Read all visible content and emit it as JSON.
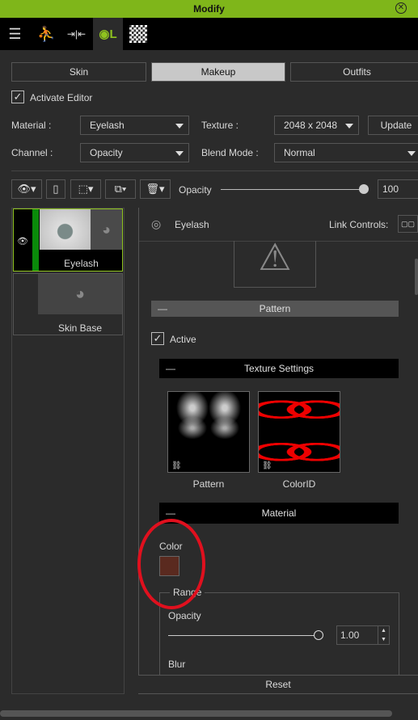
{
  "window": {
    "title": "Modify"
  },
  "toolbar_tabs": [
    {
      "icon": "sliders-icon",
      "glyph": "☰"
    },
    {
      "icon": "motion-icon",
      "glyph": "⛹"
    },
    {
      "icon": "morph-icon",
      "glyph": "⇥⇤"
    },
    {
      "icon": "appearance-editor-icon",
      "glyph": "🎨",
      "active": true
    },
    {
      "icon": "checker-texture-icon",
      "glyph": "▦"
    }
  ],
  "category_tabs": [
    {
      "label": "Skin"
    },
    {
      "label": "Makeup",
      "selected": true
    },
    {
      "label": "Outfits"
    }
  ],
  "activate_editor": {
    "label": "Activate Editor",
    "checked": true
  },
  "material": {
    "label": "Material :",
    "value": "Eyelash"
  },
  "texture": {
    "label": "Texture :",
    "value": "2048 x 2048"
  },
  "update_label": "Update",
  "channel": {
    "label": "Channel :",
    "value": "Opacity"
  },
  "blend_mode": {
    "label": "Blend Mode :",
    "value": "Normal"
  },
  "layer_toolbar": {
    "opacity_label": "Opacity",
    "opacity_value": "100",
    "opacity_percent": 100
  },
  "layers": [
    {
      "name": "Eyelash",
      "selected": true,
      "visible": true
    },
    {
      "name": "Skin Base"
    }
  ],
  "panel": {
    "title": "Eyelash",
    "link_controls": "Link Controls:",
    "pattern_header": "Pattern",
    "active_label": "Active",
    "active_checked": true,
    "texture_settings_header": "Texture Settings",
    "thumbnails": [
      {
        "label": "Pattern"
      },
      {
        "label": "ColorID"
      }
    ],
    "material_header": "Material",
    "color_label": "Color",
    "color_value": "#5a2a1f",
    "range_label": "Range",
    "opacity_label": "Opacity",
    "opacity_value": "1.00",
    "opacity_fraction": 1.0,
    "blur_label": "Blur",
    "reset_label": "Reset"
  },
  "colors": {
    "accent": "#7fb61a",
    "annotation": "#e0101e"
  }
}
